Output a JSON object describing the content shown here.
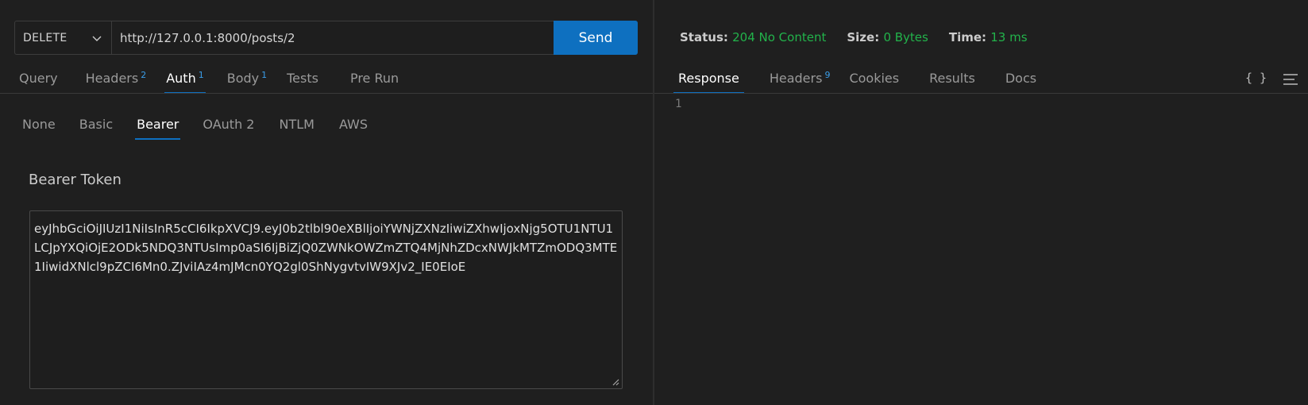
{
  "request": {
    "method": "DELETE",
    "url": "http://127.0.0.1:8000/posts/2",
    "send_label": "Send",
    "tabs": [
      {
        "label": "Query",
        "badge": ""
      },
      {
        "label": "Headers",
        "badge": "2"
      },
      {
        "label": "Auth",
        "badge": "1"
      },
      {
        "label": "Body",
        "badge": "1"
      },
      {
        "label": "Tests",
        "badge": ""
      },
      {
        "label": "Pre Run",
        "badge": ""
      }
    ],
    "active_tab": "Auth"
  },
  "auth": {
    "tabs": [
      "None",
      "Basic",
      "Bearer",
      "OAuth 2",
      "NTLM",
      "AWS"
    ],
    "active_tab": "Bearer",
    "bearer_label": "Bearer Token",
    "token": "eyJhbGciOiJIUzI1NiIsInR5cCI6IkpXVCJ9.eyJ0b2tlbl90eXBlIjoiYWNjZXNzIiwiZXhwIjoxNjg5OTU1NTU1LCJpYXQiOjE2ODk5NDQ3NTUsImp0aSI6IjBiZjQ0ZWNkOWZmZTQ4MjNhZDcxNWJkMTZmODQ3MTE1IiwidXNlcl9pZCI6Mn0.ZJviIAz4mJMcn0YQ2gl0ShNygvtvIW9XJv2_IE0EIoE"
  },
  "response": {
    "status_label": "Status:",
    "status_value": "204 No Content",
    "size_label": "Size:",
    "size_value": "0 Bytes",
    "time_label": "Time:",
    "time_value": "13 ms",
    "tabs": [
      {
        "label": "Response",
        "badge": ""
      },
      {
        "label": "Headers",
        "badge": "9"
      },
      {
        "label": "Cookies",
        "badge": ""
      },
      {
        "label": "Results",
        "badge": ""
      },
      {
        "label": "Docs",
        "badge": ""
      }
    ],
    "active_tab": "Response",
    "format_icon": "{ }",
    "line_number": "1"
  },
  "colors": {
    "accent": "#0e70c0",
    "success": "#22b34b",
    "badge": "#3a9de8"
  }
}
